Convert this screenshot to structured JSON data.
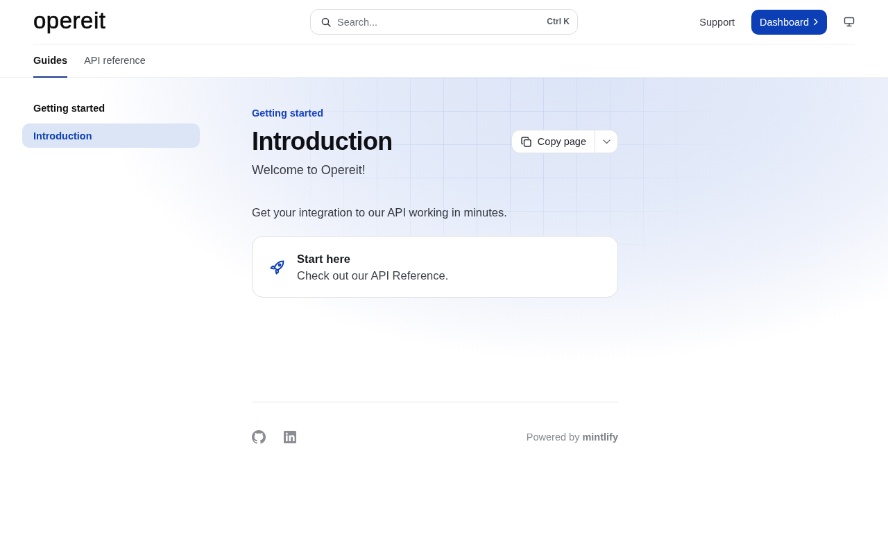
{
  "header": {
    "logo": "opereit",
    "search": {
      "placeholder": "Search...",
      "shortcut": "Ctrl K"
    },
    "actions": [
      {
        "label": "Support",
        "kind": "link"
      },
      {
        "label": "Dashboard",
        "kind": "primary"
      }
    ]
  },
  "tabs": [
    {
      "label": "Guides",
      "selected": true
    },
    {
      "label": "API reference",
      "selected": false
    }
  ],
  "sidebar": {
    "groups": [
      {
        "title": "Getting started",
        "items": [
          {
            "label": "Introduction",
            "selected": true
          }
        ]
      }
    ]
  },
  "page": {
    "eyebrow": "Getting started",
    "title": "Introduction",
    "subtitle": "Welcome to Opereit!",
    "copy_button": {
      "label": "Copy page"
    },
    "body": "Get your integration to our API working in minutes.",
    "cards": [
      {
        "title": "Start here",
        "description": "Check out our API Reference."
      }
    ]
  },
  "footer": {
    "socials": [
      {
        "kind": "github"
      },
      {
        "kind": "linkedin"
      }
    ],
    "powered_by": "Powered by **mintlify**"
  }
}
